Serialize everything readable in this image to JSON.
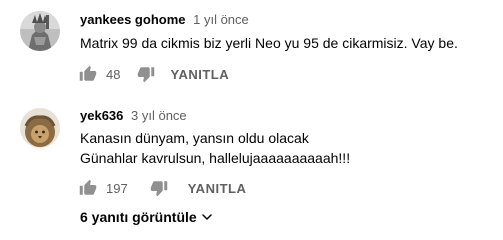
{
  "comments": [
    {
      "author": "yankees gohome",
      "time": "1 yıl önce",
      "lines": [
        "Matrix 99 da cikmis biz yerli Neo yu 95 de cikarmisiz. Vay be."
      ],
      "likes": "48",
      "reply_label": "YANITLA",
      "avatar_icon": "avatar-statue-of-liberty"
    },
    {
      "author": "yek636",
      "time": "3 yıl önce",
      "lines": [
        "Kanasın dünyam, yansın oldu olacak",
        "Günahlar kavrulsun, hallelujaaaaaaaaaah!!!"
      ],
      "likes": "197",
      "reply_label": "YANITLA",
      "avatar_icon": "avatar-lion"
    }
  ],
  "replies_toggle": {
    "label": "6 yanıtı görüntüle",
    "icon": "chevron-down-icon"
  },
  "colors": {
    "text_primary": "#030303",
    "text_secondary": "#606060",
    "icon": "#909090"
  }
}
